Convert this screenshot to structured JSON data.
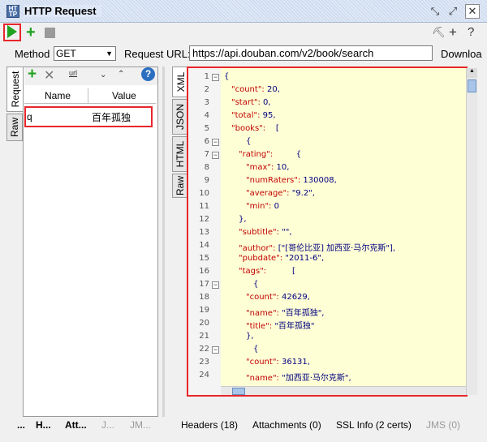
{
  "window": {
    "title": "HTTP Request",
    "icon_text": "HT\nTP"
  },
  "window_buttons": [
    "restore-icon",
    "expand-icon",
    "close-icon"
  ],
  "toolbar": {
    "run_icon": "play-icon",
    "add_icon": "plus-icon",
    "stop_icon": "stop-icon",
    "right_icons": [
      "tools-icon",
      "plus-icon",
      "help-icon"
    ]
  },
  "request": {
    "method_label": "Method",
    "method_value": "GET",
    "url_label": "Request URL:",
    "url_value": "https://api.douban.com/v2/book/search",
    "download_label": "Downloa"
  },
  "left_tabs": [
    "Request",
    "Raw"
  ],
  "params": {
    "columns": [
      "Name",
      "Value"
    ],
    "rows": [
      {
        "name": "q",
        "value": "百年孤独"
      }
    ]
  },
  "left_bottom_tabs": [
    "...",
    "H...",
    "Att...",
    "J...",
    "JM..."
  ],
  "right_tabs": [
    "XML",
    "JSON",
    "HTML",
    "Raw"
  ],
  "response_lines": [
    {
      "n": "1",
      "fold": "-",
      "indent": 0,
      "k": "",
      "v": "{"
    },
    {
      "n": "2",
      "fold": "",
      "indent": 1,
      "k": "\"count\": ",
      "v": "20,"
    },
    {
      "n": "3",
      "fold": "",
      "indent": 1,
      "k": "\"start\": ",
      "v": "0,"
    },
    {
      "n": "4",
      "fold": "",
      "indent": 1,
      "k": "\"total\": ",
      "v": "95,"
    },
    {
      "n": "5",
      "fold": "",
      "indent": 1,
      "k": "\"books\": ",
      "v": "   ["
    },
    {
      "n": "6",
      "fold": "-",
      "indent": 3,
      "k": "",
      "v": "{"
    },
    {
      "n": "7",
      "fold": "-",
      "indent": 2,
      "k": "\"rating\": ",
      "v": "        {"
    },
    {
      "n": "8",
      "fold": "",
      "indent": 3,
      "k": "\"max\": ",
      "v": "10,"
    },
    {
      "n": "9",
      "fold": "",
      "indent": 3,
      "k": "\"numRaters\": ",
      "v": "130008,"
    },
    {
      "n": "10",
      "fold": "",
      "indent": 3,
      "k": "\"average\": ",
      "v": "\"9.2\","
    },
    {
      "n": "11",
      "fold": "",
      "indent": 3,
      "k": "\"min\": ",
      "v": "0"
    },
    {
      "n": "12",
      "fold": "",
      "indent": 2,
      "k": "",
      "v": "},"
    },
    {
      "n": "13",
      "fold": "",
      "indent": 2,
      "k": "\"subtitle\": ",
      "v": "\"\","
    },
    {
      "n": "14",
      "fold": "",
      "indent": 2,
      "k": "\"author\": ",
      "v": "[\"[哥伦比亚] 加西亚·马尔克斯\"],"
    },
    {
      "n": "15",
      "fold": "",
      "indent": 2,
      "k": "\"pubdate\": ",
      "v": "\"2011-6\","
    },
    {
      "n": "16",
      "fold": "",
      "indent": 2,
      "k": "\"tags\": ",
      "v": "         ["
    },
    {
      "n": "17",
      "fold": "-",
      "indent": 4,
      "k": "",
      "v": "{"
    },
    {
      "n": "18",
      "fold": "",
      "indent": 3,
      "k": "\"count\": ",
      "v": "42629,"
    },
    {
      "n": "19",
      "fold": "",
      "indent": 3,
      "k": "\"name\": ",
      "v": "\"百年孤独\","
    },
    {
      "n": "20",
      "fold": "",
      "indent": 3,
      "k": "\"title\": ",
      "v": "\"百年孤独\""
    },
    {
      "n": "21",
      "fold": "",
      "indent": 3,
      "k": "",
      "v": "},"
    },
    {
      "n": "22",
      "fold": "-",
      "indent": 4,
      "k": "",
      "v": "{"
    },
    {
      "n": "23",
      "fold": "",
      "indent": 3,
      "k": "\"count\": ",
      "v": "36131,"
    },
    {
      "n": "24",
      "fold": "",
      "indent": 3,
      "k": "\"name\": ",
      "v": "\"加西亚·马尔克斯\","
    }
  ],
  "right_bottom_tabs": [
    {
      "label": "Headers (18)",
      "dim": false
    },
    {
      "label": "Attachments (0)",
      "dim": false
    },
    {
      "label": "SSL Info (2 certs)",
      "dim": false
    },
    {
      "label": "JMS (0)",
      "dim": true
    }
  ],
  "colors": {
    "highlight": "#e8262b",
    "run": "#1fa31f",
    "json_key": "#c00000",
    "editor_bg": "#ffffd6"
  }
}
